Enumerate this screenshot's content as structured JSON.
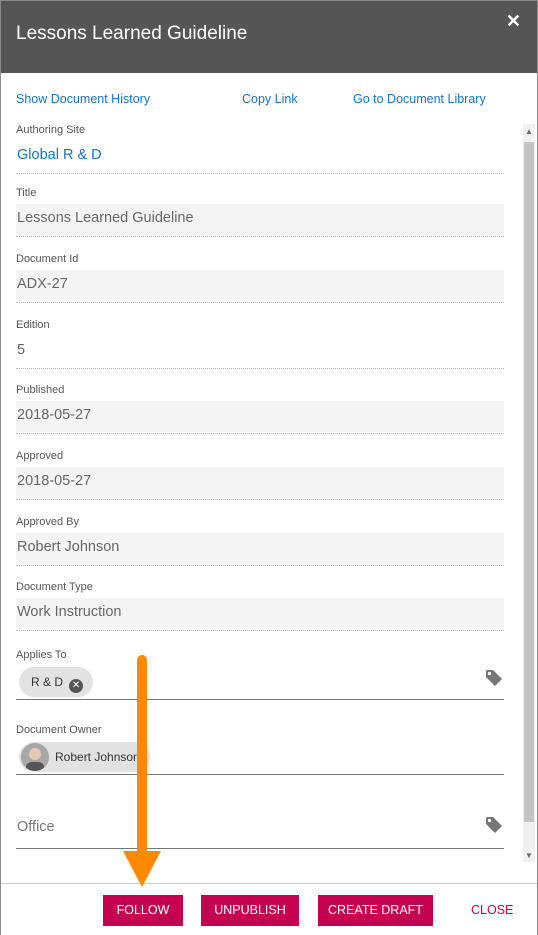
{
  "dialog": {
    "title": "Lessons Learned Guideline",
    "close_icon": "close-icon"
  },
  "links": {
    "history": "Show Document History",
    "copy": "Copy Link",
    "library": "Go to Document Library"
  },
  "fields": {
    "authoring_site": {
      "label": "Authoring Site",
      "value": "Global R & D"
    },
    "title": {
      "label": "Title",
      "value": "Lessons Learned Guideline"
    },
    "document_id": {
      "label": "Document Id",
      "value": "ADX-27"
    },
    "edition": {
      "label": "Edition",
      "value": "5"
    },
    "published": {
      "label": "Published",
      "value": "2018-05-27"
    },
    "approved": {
      "label": "Approved",
      "value": "2018-05-27"
    },
    "approved_by": {
      "label": "Approved By",
      "value": "Robert Johnson"
    },
    "document_type": {
      "label": "Document Type",
      "value": "Work Instruction"
    },
    "applies_to": {
      "label": "Applies To",
      "chip": "R & D",
      "icon": "tag-icon"
    },
    "document_owner": {
      "label": "Document Owner",
      "chip": "Robert Johnson"
    },
    "office": {
      "placeholder": "Office",
      "icon": "tag-icon"
    }
  },
  "footer": {
    "follow": "FOLLOW",
    "unpublish": "UNPUBLISH",
    "create_draft": "CREATE DRAFT",
    "close": "CLOSE"
  },
  "colors": {
    "header": "#565656",
    "accent": "#c4004f",
    "link": "#1a73b8",
    "annotation_arrow": "#ff8a00"
  }
}
